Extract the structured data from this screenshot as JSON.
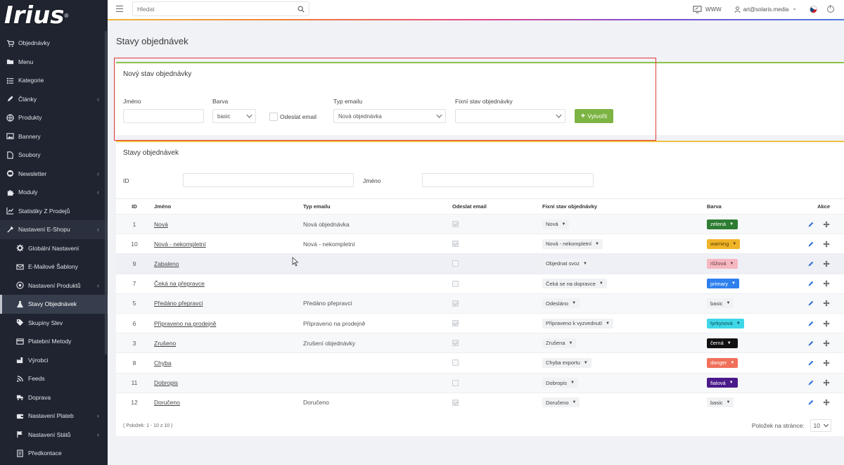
{
  "app": {
    "logo_text": "Irius",
    "logo_reg": "®"
  },
  "sidebar": {
    "items": [
      {
        "label": "Objednávky",
        "icon": "cart-icon",
        "chevron": ""
      },
      {
        "label": "Menu",
        "icon": "folder-icon",
        "chevron": ""
      },
      {
        "label": "Kategorie",
        "icon": "list-icon",
        "chevron": ""
      },
      {
        "label": "Články",
        "icon": "pencil-icon",
        "chevron": "‹"
      },
      {
        "label": "Produkty",
        "icon": "globe-icon",
        "chevron": ""
      },
      {
        "label": "Bannery",
        "icon": "image-icon",
        "chevron": ""
      },
      {
        "label": "Soubory",
        "icon": "file-icon",
        "chevron": ""
      },
      {
        "label": "Newsletter",
        "icon": "mail-circle-icon",
        "chevron": "‹"
      },
      {
        "label": "Moduly",
        "icon": "puzzle-icon",
        "chevron": "‹"
      },
      {
        "label": "Statistiky Z Prodejů",
        "icon": "chart-icon",
        "chevron": ""
      },
      {
        "label": "Nastavení E-Shopu",
        "icon": "tools-icon",
        "chevron": "‹"
      },
      {
        "label": "Globální Nastavení",
        "icon": "gear-icon",
        "chevron": ""
      },
      {
        "label": "E-Mailové Šablony",
        "icon": "envelope-icon",
        "chevron": ""
      },
      {
        "label": "Nastavení Produktů",
        "icon": "cog-circle-icon",
        "chevron": "‹"
      },
      {
        "label": "Stavy Objednávek",
        "icon": "flask-icon",
        "chevron": ""
      },
      {
        "label": "Skupiny Slev",
        "icon": "tag-icon",
        "chevron": ""
      },
      {
        "label": "Platební Metody",
        "icon": "card-icon",
        "chevron": ""
      },
      {
        "label": "Výrobci",
        "icon": "factory-icon",
        "chevron": ""
      },
      {
        "label": "Feeds",
        "icon": "feed-icon",
        "chevron": ""
      },
      {
        "label": "Doprava",
        "icon": "truck-icon",
        "chevron": ""
      },
      {
        "label": "Nastavení Plateb",
        "icon": "wallet-icon",
        "chevron": "‹"
      },
      {
        "label": "Nastavení Států",
        "icon": "flag-icon",
        "chevron": "‹"
      },
      {
        "label": "Předkontace",
        "icon": "doc-icon",
        "chevron": ""
      }
    ]
  },
  "topbar": {
    "search_placeholder": "Hledat",
    "www_label": "WWW",
    "user_email": "art@solaris.media",
    "user_chevron": "⌄"
  },
  "page": {
    "title": "Stavy objednávek"
  },
  "new_state_form": {
    "title": "Nový stav objednávky",
    "name_label": "Jméno",
    "name_value": "",
    "color_label": "Barva",
    "color_value": "basic",
    "send_email_label": "Odeslat email",
    "email_type_label": "Typ emailu",
    "email_type_value": "Nová objednávka",
    "fixed_state_label": "Fixní stav objednávky",
    "fixed_state_value": "",
    "create_button": "Vytvořit",
    "create_icon": "plus-icon"
  },
  "list": {
    "title": "Stavy objednávek",
    "filter_id_label": "ID",
    "filter_id_value": "",
    "filter_name_label": "Jméno",
    "filter_name_value": "",
    "columns": {
      "id": "ID",
      "name": "Jméno",
      "email_type": "Typ emailu",
      "send_email": "Odeslat email",
      "fixed_state": "Fixní stav objednávky",
      "color": "Barva",
      "actions": "Akce"
    },
    "rows": [
      {
        "id": "1",
        "name": "Nová",
        "email_type": "Nová objednávka",
        "send": true,
        "fixed": "Nová",
        "color": "zelená",
        "color_hex": "#2e7d32",
        "color_text": "#ffffff"
      },
      {
        "id": "10",
        "name": "Nová - nekompletní",
        "email_type": "Nová - nekompletní",
        "send": true,
        "fixed": "Nová - nekompletní",
        "color": "warning",
        "color_hex": "#f0b429",
        "color_text": "#5a4000"
      },
      {
        "id": "9",
        "name": "Zabaleno",
        "email_type": "",
        "send": false,
        "fixed": "Objednat svoz",
        "color": "růžová",
        "color_hex": "#f6b8c0",
        "color_text": "#6a3a40"
      },
      {
        "id": "7",
        "name": "Čeká na přepravce",
        "email_type": "",
        "send": false,
        "fixed": "Čeká se na dopravce",
        "color": "primary",
        "color_hex": "#2f80ed",
        "color_text": "#ffffff"
      },
      {
        "id": "5",
        "name": "Předáno přepravci",
        "email_type": "Předáno přepravci",
        "send": true,
        "fixed": "Odesláno",
        "color": "basic",
        "color_hex": "",
        "color_text": ""
      },
      {
        "id": "6",
        "name": "Připraveno na prodejně",
        "email_type": "Připraveno na prodejně",
        "send": true,
        "fixed": "Připraveno k vyzvednutí",
        "color": "tyrkysová",
        "color_hex": "#3fd7e8",
        "color_text": "#0b4a52"
      },
      {
        "id": "3",
        "name": "Zrušeno",
        "email_type": "Zrušení objednávky",
        "send": true,
        "fixed": "Zrušena",
        "color": "černá",
        "color_hex": "#111111",
        "color_text": "#ffffff"
      },
      {
        "id": "8",
        "name": "Chyba",
        "email_type": "",
        "send": false,
        "fixed": "Chyba exportu",
        "color": "danger",
        "color_hex": "#f0705a",
        "color_text": "#ffffff"
      },
      {
        "id": "11",
        "name": "Dobropis",
        "email_type": "",
        "send": false,
        "fixed": "Dobropis",
        "color": "fialová",
        "color_hex": "#4a1a8a",
        "color_text": "#ffffff"
      },
      {
        "id": "12",
        "name": "Doručeno",
        "email_type": "Doručeno",
        "send": true,
        "fixed": "Doručeno",
        "color": "basic",
        "color_hex": "",
        "color_text": ""
      }
    ],
    "items_count": "( Položek: 1 - 10 z 10 )",
    "per_page_label": "Položek na stránce:",
    "per_page_value": "10"
  },
  "colors": {
    "sidebar_bg": "#1f2430",
    "create_green": "#7cb342",
    "highlight_red": "#e53935",
    "card_top_green": "#8bc34a",
    "card_top_yellow": "#f0c040"
  }
}
